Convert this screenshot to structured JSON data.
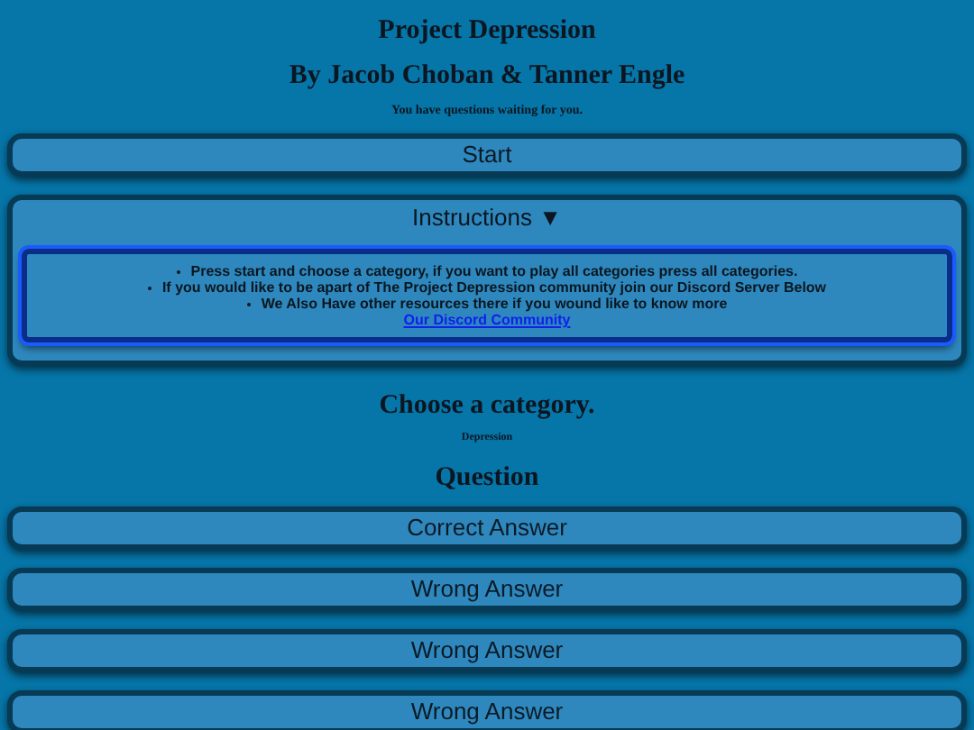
{
  "title": "Project Depression",
  "byline": "By Jacob Choban & Tanner Engle",
  "note": "You have questions waiting for you.",
  "start_button": "Start",
  "instructions": {
    "label": "Instructions ▼",
    "expanded": true,
    "items": [
      "Press start and choose a category, if you want to play all categories press all categories.",
      "If you would like to be apart of The Project Depression community join our Discord Server Below",
      "We Also Have other resources there if you wound like to know more"
    ],
    "link": "Our Discord Community"
  },
  "category_heading": "Choose a category.",
  "categories": [
    "Depression"
  ],
  "question": "Question",
  "answers": [
    "Correct Answer",
    "Wrong Answer",
    "Wrong Answer",
    "Wrong Answer"
  ]
}
